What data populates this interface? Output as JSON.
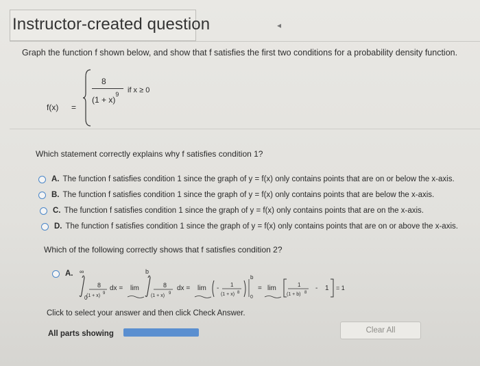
{
  "header": {
    "title": "Instructor-created question",
    "collapse_symbol": "◂"
  },
  "problem": {
    "prompt": "Graph the function f shown below, and show that f satisfies the first two conditions for a probability density function.",
    "f_label": "f(x)",
    "equals": "=",
    "numerator": "8",
    "denominator_base": "(1 + x)",
    "denominator_exp": "9",
    "condition": "if x ≥ 0"
  },
  "question1": {
    "text": "Which statement correctly explains why f satisfies condition 1?",
    "options": [
      {
        "letter": "A.",
        "text": "The function f satisfies condition 1 since the graph of y = f(x) only contains points that are on or below the x-axis."
      },
      {
        "letter": "B.",
        "text": "The function f satisfies condition 1 since the graph of y = f(x) only contains points that are below the x-axis."
      },
      {
        "letter": "C.",
        "text": "The function f satisfies condition 1 since the graph of y = f(x) only contains points that are on the x-axis."
      },
      {
        "letter": "D.",
        "text": "The function f satisfies condition 1 since the graph of y = f(x) only contains points that are on or above the x-axis."
      }
    ]
  },
  "question2": {
    "text": "Which of the following correctly shows that f satisfies condition 2?",
    "option_letter": "A.",
    "math": {
      "upper_inf": "∞",
      "lower_zero": "0",
      "frac1_num": "8",
      "frac1_den": "(1 + x)",
      "frac1_exp": "9",
      "dx1": "dx =",
      "lim1": "lim",
      "upper_b": "b",
      "frac2_num": "8",
      "frac2_den": "(1 + x)",
      "frac2_exp": "9",
      "dx2": "dx =",
      "lim2": "lim",
      "frac3_num": "1",
      "frac3_den": "(1 + x)",
      "frac3_exp": "8",
      "eval_upper": "b",
      "eval_lower": "0",
      "eq3": "=",
      "lim3": "lim",
      "frac4_num": "1",
      "frac4_den": "(1 + b)",
      "frac4_exp": "8",
      "minus": "-",
      "one": "1",
      "result": "= 1"
    }
  },
  "footer": {
    "instruction": "Click to select your answer and then click Check Answer.",
    "all_parts": "All parts showing",
    "progress": 1.0,
    "clear_label": "Clear All"
  },
  "colors": {
    "radio": "#4a86c8",
    "progress": "#5b8fd0"
  }
}
